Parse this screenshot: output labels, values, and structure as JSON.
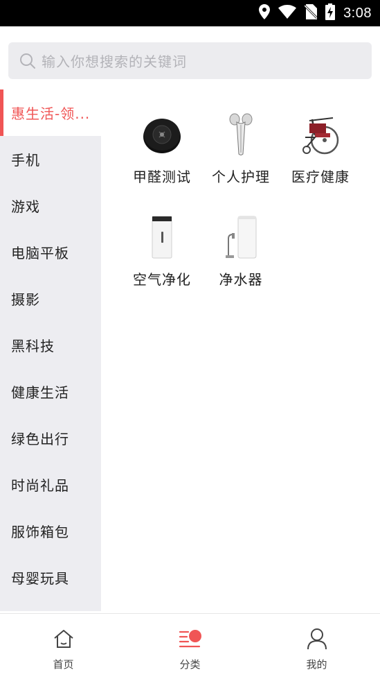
{
  "status_bar": {
    "time": "3:08"
  },
  "search": {
    "placeholder": "输入你想搜索的关键词"
  },
  "sidebar": {
    "items": [
      {
        "label": "惠生活-领..."
      },
      {
        "label": "手机"
      },
      {
        "label": "游戏"
      },
      {
        "label": "电脑平板"
      },
      {
        "label": "摄影"
      },
      {
        "label": "黑科技"
      },
      {
        "label": "健康生活"
      },
      {
        "label": "绿色出行"
      },
      {
        "label": "时尚礼品"
      },
      {
        "label": "服饰箱包"
      },
      {
        "label": "母婴玩具"
      }
    ]
  },
  "categories": [
    {
      "name": "甲醛测试",
      "icon": "formaldehyde-detector-icon"
    },
    {
      "name": "个人护理",
      "icon": "face-roller-icon"
    },
    {
      "name": "医疗健康",
      "icon": "wheelchair-icon"
    },
    {
      "name": "空气净化",
      "icon": "air-purifier-icon"
    },
    {
      "name": "净水器",
      "icon": "water-purifier-icon"
    }
  ],
  "tabbar": {
    "tabs": [
      {
        "label": "首页"
      },
      {
        "label": "分类"
      },
      {
        "label": "我的"
      }
    ]
  },
  "colors": {
    "accent": "#f05555",
    "sidebar_bg": "#ededf1",
    "search_bg": "#ececef"
  }
}
